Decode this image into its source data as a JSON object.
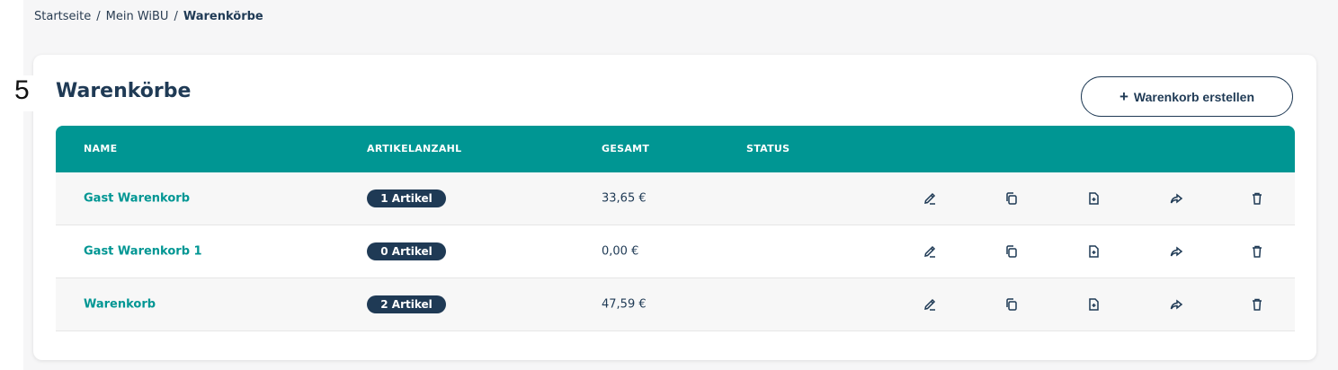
{
  "breadcrumb": {
    "items": [
      "Startseite",
      "Mein WiBU"
    ],
    "separator": "/",
    "current": "Warenkörbe"
  },
  "step_number": "5",
  "card": {
    "title": "Warenkörbe",
    "create_button": {
      "plus": "+",
      "label": "Warenkorb erstellen"
    }
  },
  "table": {
    "headers": {
      "name": "NAME",
      "count": "ARTIKELANZAHL",
      "total": "GESAMT",
      "status": "STATUS"
    },
    "rows": [
      {
        "name": "Gast Warenkorb",
        "count": "1 Artikel",
        "total": "33,65 €",
        "status": ""
      },
      {
        "name": "Gast Warenkorb 1",
        "count": "0 Artikel",
        "total": "0,00 €",
        "status": ""
      },
      {
        "name": "Warenkorb",
        "count": "2 Artikel",
        "total": "47,59 €",
        "status": ""
      }
    ],
    "actions": [
      "edit-icon",
      "copy-icon",
      "file-add-icon",
      "share-icon",
      "trash-icon"
    ]
  },
  "colors": {
    "teal": "#009693",
    "navy": "#1f3a55",
    "background": "#f6f6f7"
  }
}
